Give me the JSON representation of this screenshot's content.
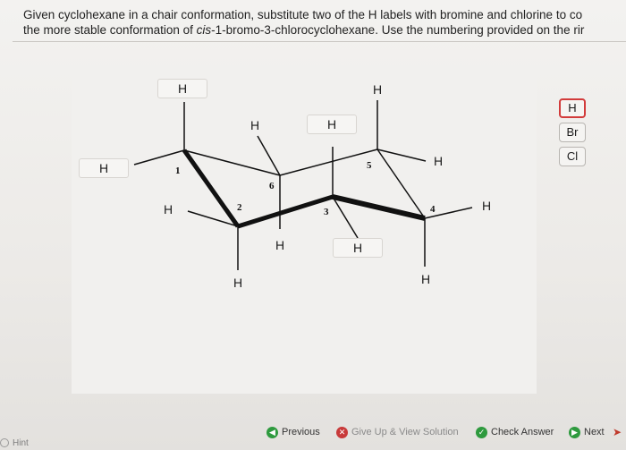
{
  "question": {
    "line1": "Given cyclohexane in a chair conformation, substitute two of the H labels with bromine and chlorine to co",
    "line2_before": "the more stable conformation of ",
    "line2_compound": "cis",
    "line2_after": "-1-bromo-3-chlorocyclohexane. Use the numbering provided on the rir"
  },
  "ring_numbers": [
    "1",
    "2",
    "3",
    "4",
    "5",
    "6"
  ],
  "h_labels": {
    "c1_up": "H",
    "c1_eq": "H",
    "c2_eq": "H",
    "c2_down": "H",
    "c3_down": "H",
    "c4_eq": "H",
    "c4_down": "H",
    "c5_up": "H",
    "c5_eq": "H",
    "c6_eq": "H",
    "c6_down": "H",
    "c3_up": "H"
  },
  "palette": {
    "h": "H",
    "br": "Br",
    "cl": "Cl"
  },
  "footer": {
    "previous": "Previous",
    "give_up": "Give Up & View Solution",
    "check": "Check Answer",
    "next": "Next",
    "hint": "Hint"
  },
  "colors": {
    "accent_green": "#2e9a3e",
    "accent_red": "#c83a3a"
  }
}
